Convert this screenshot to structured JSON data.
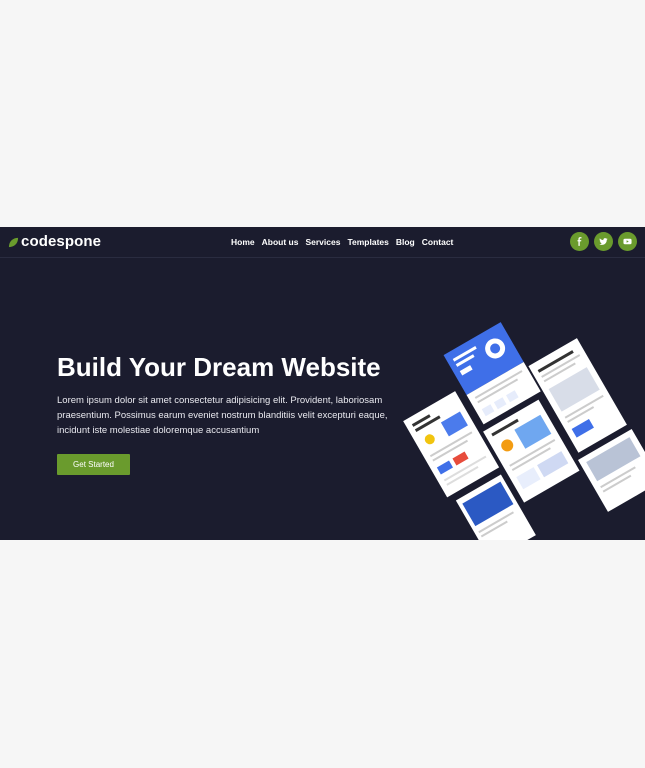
{
  "logo": {
    "text": "codespone"
  },
  "nav": {
    "items": [
      {
        "label": "Home"
      },
      {
        "label": "About us"
      },
      {
        "label": "Services"
      },
      {
        "label": "Templates"
      },
      {
        "label": "Blog"
      },
      {
        "label": "Contact"
      }
    ]
  },
  "social": [
    {
      "icon": "facebook-icon",
      "glyph": "f"
    },
    {
      "icon": "twitter-icon"
    },
    {
      "icon": "youtube-icon"
    }
  ],
  "hero": {
    "title": "Build Your Dream Website",
    "description": "Lorem ipsum dolor sit amet consectetur adipisicing elit. Provident, laboriosam praesentium. Possimus earum eveniet nostrum blanditiis velit excepturi eaque, incidunt iste molestiae doloremque accusantium",
    "cta_label": "Get Started"
  },
  "colors": {
    "page_bg": "#f6f6f6",
    "site_bg": "#1b1c2e",
    "accent": "#6a9b2d",
    "mockup_blue": "#3f6fe8",
    "text": "#ffffff"
  }
}
